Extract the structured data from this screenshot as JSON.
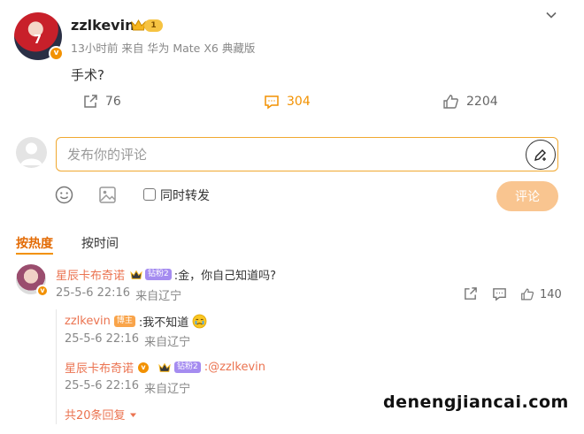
{
  "post": {
    "username": "zzlkevin",
    "level": "1",
    "avatar_number": "7",
    "verified_icon": "v",
    "meta": "13小时前 来自 华为 Mate X6 典藏版",
    "text": "手术?",
    "shares": "76",
    "comments": "304",
    "likes": "2204"
  },
  "composer": {
    "placeholder": "发布你的评论",
    "repost_label": "同时转发",
    "submit_label": "评论"
  },
  "sort_tabs": {
    "hot": "按热度",
    "time": "按时间"
  },
  "comment": {
    "author": "星辰卡布奇诺",
    "fan_badge": "钻粉2",
    "text": ":金，你自己知道吗?",
    "date": "25-5-6 22:16",
    "location": "来自辽宁",
    "likes": "140",
    "replies": [
      {
        "author": "zzlkevin",
        "badge": "博主",
        "text": ":我不知道",
        "date": "25-5-6 22:16",
        "location": "来自辽宁"
      },
      {
        "author": "星辰卡布奇诺",
        "badge": "钻粉2",
        "text": ":@zzlkevin",
        "date": "25-5-6 22:16",
        "location": "来自辽宁"
      }
    ],
    "more_replies": "共20条回复"
  },
  "watermark": "denengjiancai.com",
  "colors": {
    "accent": "#f29100",
    "name": "#eb7350",
    "submit_disabled": "#f9c590"
  }
}
